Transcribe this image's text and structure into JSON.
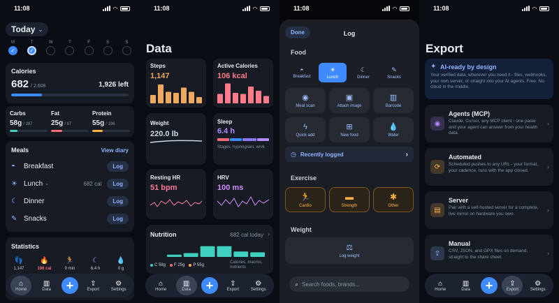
{
  "status": {
    "time": "11:08"
  },
  "tabbar": {
    "home": "Home",
    "data": "Data",
    "export": "Export",
    "settings": "Settings"
  },
  "colors": {
    "accent": "#3d8bff",
    "calories": "#3d8bff",
    "carbs": "#3fd0c0",
    "fat": "#ff6b7a",
    "protein": "#ffb347",
    "steps": "#f0a860",
    "active": "#ff7a8a",
    "weight": "#cfd6e4",
    "sleep": "#b38cff",
    "resting_hr": "#ff7a9a",
    "hrv": "#d48cff",
    "nutrition": "#3fd0c0"
  },
  "home": {
    "today_label": "Today",
    "week": [
      {
        "letter": "M",
        "state": "done"
      },
      {
        "letter": "T",
        "state": "current"
      },
      {
        "letter": "W",
        "state": "empty"
      },
      {
        "letter": "T",
        "state": "empty"
      },
      {
        "letter": "F",
        "state": "empty"
      },
      {
        "letter": "S",
        "state": "empty"
      },
      {
        "letter": "S",
        "state": "empty"
      }
    ],
    "calories": {
      "title": "Calories",
      "value": "682",
      "goal": "/ 2,608",
      "left": "1,926 left",
      "progress": 0.26
    },
    "macros": [
      {
        "name": "Carbs",
        "value": "58g",
        "goal": "/ 287",
        "progress": 0.2
      },
      {
        "name": "Fat",
        "value": "25g",
        "goal": "/ 87",
        "progress": 0.29
      },
      {
        "name": "Protein",
        "value": "55g",
        "goal": "/ 196",
        "progress": 0.28
      }
    ],
    "meals": {
      "title": "Meals",
      "view_diary": "View diary",
      "items": [
        {
          "name": "Breakfast",
          "cal": "",
          "action": "Log"
        },
        {
          "name": "Lunch",
          "cal": "682 cal",
          "action": "Log"
        },
        {
          "name": "Dinner",
          "cal": "",
          "action": "Log"
        },
        {
          "name": "Snacks",
          "cal": "",
          "action": "Log"
        }
      ]
    },
    "statistics": {
      "title": "Statistics",
      "items": [
        {
          "icon": "footprints-icon",
          "value": "1,147"
        },
        {
          "icon": "flame-icon",
          "value": "106 cal"
        },
        {
          "icon": "runner-icon",
          "value": "0 min"
        },
        {
          "icon": "moon-icon",
          "value": "6.4 h"
        },
        {
          "icon": "drop-icon",
          "value": "0 g"
        }
      ]
    }
  },
  "data": {
    "title": "Data",
    "steps": {
      "label": "Steps",
      "value": "1,147",
      "bars": [
        0.4,
        0.9,
        0.55,
        0.5,
        0.75,
        0.55,
        0.3
      ]
    },
    "active": {
      "label": "Active Calories",
      "value": "106 kcal",
      "bars": [
        0.45,
        0.95,
        0.5,
        0.45,
        0.8,
        0.6,
        0.35
      ]
    },
    "weight": {
      "label": "Weight",
      "value": "220.0 lb"
    },
    "sleep": {
      "label": "Sleep",
      "value": "6.4 h",
      "caption": "Stages, hypnogram, wrvk"
    },
    "resting_hr": {
      "label": "Resting HR",
      "value": "51 bpm"
    },
    "hrv": {
      "label": "HRV",
      "value": "100 ms"
    },
    "nutrition": {
      "label": "Nutrition",
      "summary": "682 cal today",
      "bars": [
        0.15,
        0.25,
        0.7,
        0.7,
        0.35,
        0.3
      ],
      "legend": [
        {
          "label": "C 58g",
          "color": "#3fd0c0"
        },
        {
          "label": "F 25g",
          "color": "#ff6b7a"
        },
        {
          "label": "P 55g",
          "color": "#ffb347"
        }
      ],
      "caption": "Calories, macros, nutrients"
    }
  },
  "log": {
    "done": "Done",
    "title": "Log",
    "food_section": "Food",
    "meal_tabs": [
      {
        "label": "Breakfast",
        "icon": "sunrise-icon",
        "selected": false
      },
      {
        "label": "Lunch",
        "icon": "sun-icon",
        "selected": true
      },
      {
        "label": "Dinner",
        "icon": "moon-icon",
        "selected": false
      },
      {
        "label": "Snacks",
        "icon": "carrot-icon",
        "selected": false
      }
    ],
    "tiles": [
      {
        "label": "Meal scan",
        "icon": "camera-icon"
      },
      {
        "label": "Attach image",
        "icon": "image-icon"
      },
      {
        "label": "Barcode",
        "icon": "barcode-icon"
      },
      {
        "label": "Quick add",
        "icon": "bolt-icon"
      },
      {
        "label": "New food",
        "icon": "new-food-icon"
      },
      {
        "label": "Water",
        "icon": "drop-icon"
      }
    ],
    "recently": "Recently logged",
    "exercise_section": "Exercise",
    "exercise": [
      {
        "label": "Cardio",
        "icon": "runner-icon"
      },
      {
        "label": "Strength",
        "icon": "dumbbell-icon"
      },
      {
        "label": "Other",
        "icon": "figure-icon"
      }
    ],
    "weight_section": "Weight",
    "log_weight": "Log weight",
    "search_placeholder": "Search foods, brands..."
  },
  "export": {
    "title": "Export",
    "hero": {
      "title": "AI-ready by design",
      "desc": "Your verified data, wherever you need it - files, webhooks, your own server, or straight into your AI agents. Free. No cloud in the middle."
    },
    "items": [
      {
        "title": "Agents (MCP)",
        "desc": "Claude, Cursor, any MCP client - one paste and your agent can answer from your health data.",
        "icon": "antenna-icon",
        "color": "#b38cff"
      },
      {
        "title": "Automated",
        "desc": "Scheduled pushes to any URL - your format, your cadence, runs with the app closed.",
        "icon": "sync-icon",
        "color": "#ffb347"
      },
      {
        "title": "Server",
        "desc": "Pair with a self-hosted server for a complete, live mirror on hardware you own.",
        "icon": "server-icon",
        "color": "#ffb347"
      },
      {
        "title": "Manual",
        "desc": "CSV, JSON, and GPX files on demand, straight to the share sheet.",
        "icon": "share-icon",
        "color": "#8fb4ff"
      }
    ]
  }
}
